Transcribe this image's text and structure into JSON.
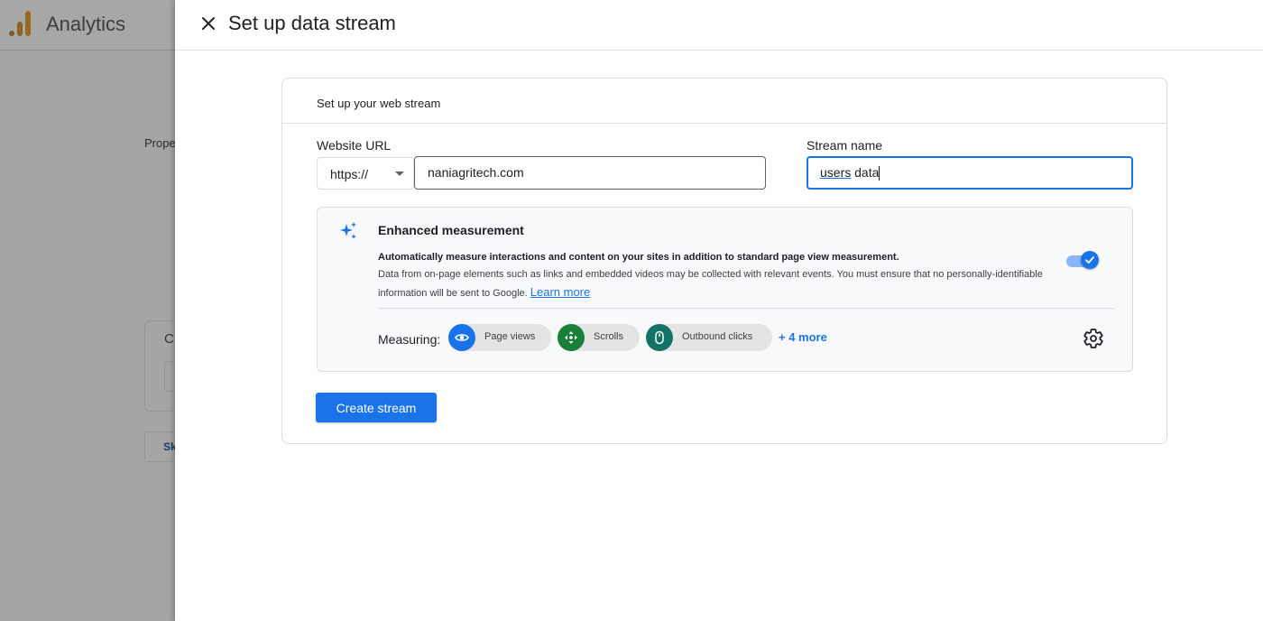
{
  "background": {
    "app_title": "Analytics",
    "property_text": "Prope",
    "card_letter": "C",
    "button_text": "Sk"
  },
  "drawer": {
    "title": "Set up data stream",
    "close_icon": "close-icon"
  },
  "web_stream": {
    "heading": "Set up your web stream",
    "website_url_label": "Website URL",
    "protocol_selected": "https://",
    "url_value": "naniagritech.com",
    "stream_name_label": "Stream name",
    "stream_name_value_underlined": "users",
    "stream_name_value_rest": " data"
  },
  "enhanced_measurement": {
    "title": "Enhanced measurement",
    "bold_text": "Automatically measure interactions and content on your sites in addition to standard page view measurement.",
    "description": "Data from on-page elements such as links and embedded videos may be collected with relevant events. You must ensure that no personally-identifiable information will be sent to Google.",
    "learn_more": "Learn more",
    "toggle_on": true,
    "measuring_label": "Measuring:",
    "chips": [
      {
        "label": "Page views",
        "icon": "eye-icon",
        "color": "#1a73e8"
      },
      {
        "label": "Scrolls",
        "icon": "scroll-arrows-icon",
        "color": "#188038"
      },
      {
        "label": "Outbound clicks",
        "icon": "mouse-icon",
        "color": "#137367"
      }
    ],
    "more_link": "+ 4 more"
  },
  "actions": {
    "create_button": "Create stream"
  },
  "colors": {
    "primary": "#1a73e8",
    "toggle_track": "#8ab4f8"
  }
}
